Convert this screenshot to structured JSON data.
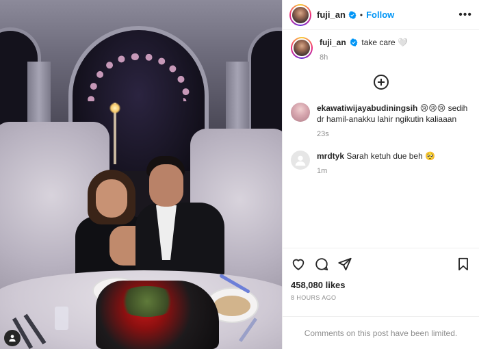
{
  "post": {
    "author": "fuji_an",
    "follow_label": "Follow",
    "separator": "•",
    "more_label": "•••",
    "caption": {
      "username": "fuji_an",
      "text": "take care 🤍",
      "time": "8h"
    },
    "comments": [
      {
        "username": "ekawatiwijayabudiningsih",
        "text": "😢😢😢 sedih dr hamil-anakku lahir ngikutin kaliaaan",
        "time": "23s"
      },
      {
        "username": "mrdtyk",
        "text": "Sarah ketuh due beh 🥺",
        "time": "1m"
      }
    ],
    "likes": "458,080 likes",
    "posted_ago": "8 HOURS AGO",
    "comments_limited": "Comments on this post have been limited."
  },
  "icons": {
    "verified": "verified-badge-icon",
    "more": "more-options-icon",
    "load_more": "add-circle-icon",
    "like": "heart-icon",
    "comment": "comment-bubble-icon",
    "share": "paper-plane-icon",
    "save": "bookmark-icon",
    "tags": "user-tag-icon"
  },
  "colors": {
    "accent": "#0095f6",
    "muted": "#8e8e8e",
    "text": "#262626",
    "border": "#efefef"
  }
}
